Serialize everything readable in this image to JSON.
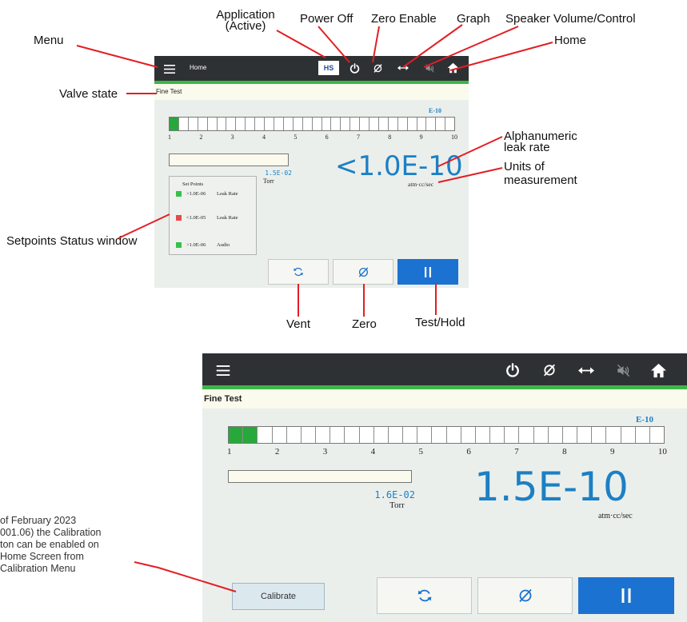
{
  "callouts": {
    "application": "Application\n(Active)",
    "power_off": "Power Off",
    "zero_enable": "Zero Enable",
    "graph": "Graph",
    "speaker": "Speaker Volume/Control",
    "home": "Home",
    "menu": "Menu",
    "valve_state": "Valve state",
    "alphanumeric": "Alphanumeric\nleak rate",
    "units_of_measurement": "Units of\nmeasurement",
    "setpoints_status": "Setpoints Status window",
    "vent": "Vent",
    "zero": "Zero",
    "test_hold": "Test/Hold"
  },
  "note_lines": [
    "of February 2023",
    "001.06) the Calibration",
    "ton can be enabled on",
    " Home Screen from",
    " Calibration Menu"
  ],
  "screen1": {
    "topbar_title": "Home",
    "application_badge": "HS",
    "valve_state": "Fine Test",
    "range_exponent": "E-10",
    "tick_labels": [
      "1",
      "2",
      "3",
      "4",
      "5",
      "6",
      "7",
      "8",
      "9",
      "10"
    ],
    "bar_segments_total": 30,
    "bar_segments_lit": 1,
    "pressure_value": "1.5E-02",
    "pressure_units": "Torr",
    "leak_rate": "<1.0E-10",
    "leak_units": "atm·cc/sec",
    "setpoints_title": "Set Points",
    "setpoints": [
      {
        "value": ">1.0E-06",
        "label": "Leak Rate",
        "color": "#3ac04a"
      },
      {
        "value": "<1.0E-05",
        "label": "Leak Rate",
        "color": "#e64b4b"
      },
      {
        "value": ">1.0E-06",
        "label": "Audio",
        "color": "#3ac04a"
      }
    ]
  },
  "screen2": {
    "valve_state": "Fine Test",
    "range_exponent": "E-10",
    "tick_labels": [
      "1",
      "2",
      "3",
      "4",
      "5",
      "6",
      "7",
      "8",
      "9",
      "10"
    ],
    "bar_segments_total": 30,
    "bar_segments_lit": 2,
    "pressure_value": "1.6E-02",
    "pressure_units": "Torr",
    "leak_rate": "1.5E-10",
    "leak_units": "atm·cc/sec",
    "calibrate_label": "Calibrate"
  },
  "colors": {
    "topbar": "#2e3133",
    "accent_green": "#3fb548",
    "leak_blue": "#1c80c4",
    "hold_button": "#1c72d0",
    "callout_line": "#e31e24"
  },
  "icons": [
    "menu-icon",
    "power-icon",
    "zero-icon",
    "graph-arrow-icon",
    "speaker-mute-icon",
    "home-icon",
    "vent-icon",
    "pause-icon"
  ]
}
